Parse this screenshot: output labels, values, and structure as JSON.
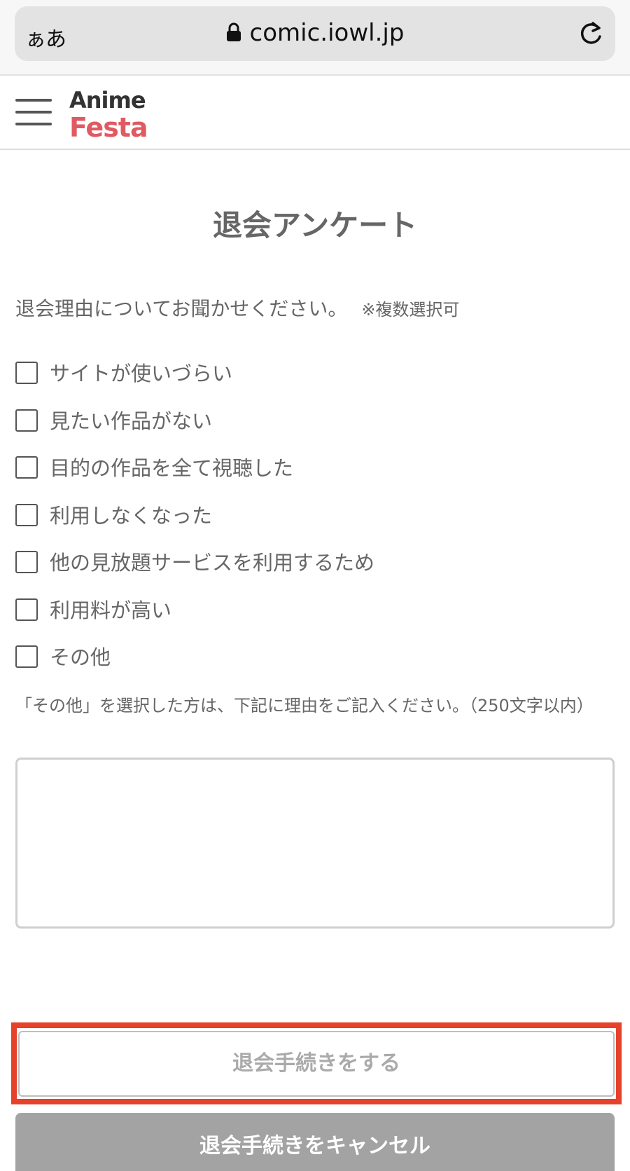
{
  "browser": {
    "text_size_label": "ぁあ",
    "url": "comic.iowl.jp"
  },
  "header": {
    "logo_line1": "Anime",
    "logo_line2": "Festa",
    "brand_color": "#e05a63"
  },
  "survey": {
    "title": "退会アンケート",
    "question": "退会理由についてお聞かせください。",
    "question_note": "※複数選択可",
    "options": [
      {
        "label": "サイトが使いづらい",
        "checked": false
      },
      {
        "label": "見たい作品がない",
        "checked": false
      },
      {
        "label": "目的の作品を全て視聴した",
        "checked": false
      },
      {
        "label": "利用しなくなった",
        "checked": false
      },
      {
        "label": "他の見放題サービスを利用するため",
        "checked": false
      },
      {
        "label": "利用料が高い",
        "checked": false
      },
      {
        "label": "その他",
        "checked": false
      }
    ],
    "other_note": "「その他」を選択した方は、下記に理由をご記入ください。（250文字以内）",
    "other_reason_value": ""
  },
  "actions": {
    "withdraw_label": "退会手続きをする",
    "cancel_label": "退会手続きをキャンセル",
    "highlight_color": "#e5412b"
  }
}
